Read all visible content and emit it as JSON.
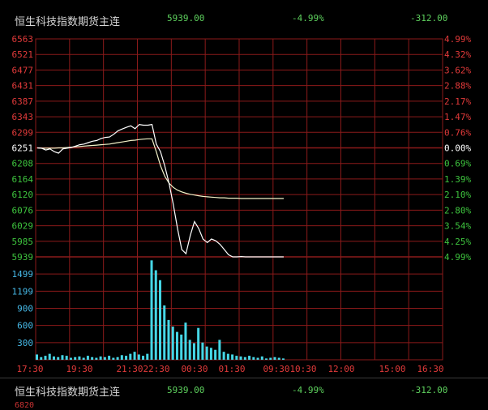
{
  "header": {
    "title": "恒生科技指数期货主连",
    "price": "5939.00",
    "pct": "-4.99%",
    "change": "-312.00"
  },
  "footer": {
    "title": "恒生科技指数期货主连",
    "price": "5939.00",
    "pct": "-4.99%",
    "change": "-312.00",
    "next_label": "6820"
  },
  "colors": {
    "grid": "#8b1a1a",
    "up": "#e23a3a",
    "down": "#3ec43e",
    "price_line": "#ffffff",
    "avg_line": "#f2f2c8",
    "volume": "#46d6e6",
    "axis_label": "#e23a3a",
    "volume_label": "#46b8e6"
  },
  "chart_data": {
    "type": "line",
    "price_axis_left": [
      "6563",
      "6521",
      "6477",
      "6431",
      "6387",
      "6343",
      "6299",
      "6251",
      "6208",
      "6164",
      "6120",
      "6076",
      "6029",
      "5985",
      "5939"
    ],
    "pct_axis_right": [
      "4.99%",
      "4.32%",
      "3.62%",
      "2.88%",
      "2.17%",
      "1.47%",
      "0.76%",
      "0.00%",
      "0.69%",
      "1.39%",
      "2.10%",
      "2.80%",
      "3.54%",
      "4.25%",
      "4.99%"
    ],
    "volume_axis": [
      "1499",
      "1199",
      "900",
      "600",
      "300"
    ],
    "time_labels": [
      "17:30",
      "19:30",
      "21:30",
      "22:30",
      "00:30",
      "01:30",
      "09:30",
      "10:30",
      "12:00",
      "15:00",
      "16:30"
    ],
    "base_price": 6251,
    "price_line": [
      6251,
      6250,
      6245,
      6248,
      6240,
      6236,
      6248,
      6250,
      6252,
      6256,
      6260,
      6262,
      6266,
      6270,
      6272,
      6278,
      6281,
      6282,
      6290,
      6300,
      6305,
      6310,
      6314,
      6306,
      6318,
      6316,
      6316,
      6318,
      6262,
      6240,
      6200,
      6150,
      6090,
      6020,
      5960,
      5948,
      6000,
      6040,
      6020,
      5990,
      5980,
      5990,
      5985,
      5975,
      5960,
      5945,
      5939,
      5939,
      5940,
      5939,
      5939,
      5939,
      5939,
      5939,
      5939,
      5939,
      5939,
      5939,
      5939
    ],
    "avg_line": [
      6251,
      6250,
      6250,
      6250,
      6250,
      6251,
      6251,
      6252,
      6253,
      6254,
      6255,
      6256,
      6257,
      6258,
      6259,
      6260,
      6261,
      6262,
      6264,
      6266,
      6268,
      6270,
      6272,
      6273,
      6275,
      6276,
      6277,
      6277,
      6240,
      6200,
      6170,
      6150,
      6138,
      6130,
      6125,
      6121,
      6118,
      6116,
      6114,
      6112,
      6111,
      6110,
      6109,
      6108,
      6108,
      6107,
      6107,
      6107,
      6106,
      6106,
      6106,
      6106,
      6106,
      6106,
      6106,
      6106,
      6106,
      6106,
      6106
    ],
    "volume": [
      80,
      40,
      60,
      90,
      50,
      40,
      70,
      60,
      30,
      40,
      50,
      30,
      60,
      40,
      30,
      50,
      40,
      60,
      30,
      40,
      70,
      60,
      90,
      120,
      80,
      60,
      90,
      1499,
      1350,
      1200,
      820,
      600,
      500,
      420,
      380,
      560,
      300,
      250,
      480,
      260,
      200,
      180,
      150,
      300,
      120,
      90,
      80,
      60,
      50,
      40,
      60,
      40,
      30,
      50,
      20,
      30,
      40,
      30,
      20
    ]
  }
}
